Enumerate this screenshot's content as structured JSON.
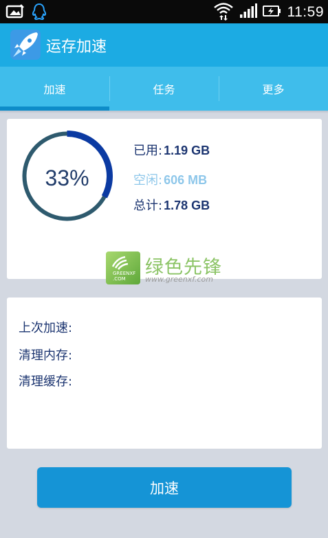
{
  "status_bar": {
    "time": "11:59",
    "icons": [
      "gallery-icon",
      "qq-icon",
      "wifi-icon",
      "signal-icon",
      "battery-charging-icon"
    ]
  },
  "action_bar": {
    "title": "运存加速",
    "logo_icon": "rocket-icon"
  },
  "tabs": [
    {
      "label": "加速",
      "active": true
    },
    {
      "label": "任务",
      "active": false
    },
    {
      "label": "更多",
      "active": false
    }
  ],
  "memory": {
    "percent_text": "33%",
    "percent_value": 33,
    "used_label": "已用:",
    "used_value": "1.19 GB",
    "free_label": "空闲:",
    "free_value": "606 MB",
    "total_label": "总计:",
    "total_value": "1.78 GB"
  },
  "watermark": {
    "badge_text": "GREENXF .COM",
    "brand": "绿色先锋",
    "url": "www.greenxf.com"
  },
  "info": {
    "last_boost_label": "上次加速:",
    "clean_memory_label": "清理内存:",
    "clean_cache_label": "清理缓存:"
  },
  "boost_button": {
    "label": "加速"
  },
  "colors": {
    "action_bar": "#1cabe3",
    "tab_bar": "#3fbdeb",
    "tab_indicator": "#0e8cc9",
    "gauge_used": "#0b3aa2",
    "gauge_track": "#2e5a6e",
    "button": "#1594d6"
  }
}
